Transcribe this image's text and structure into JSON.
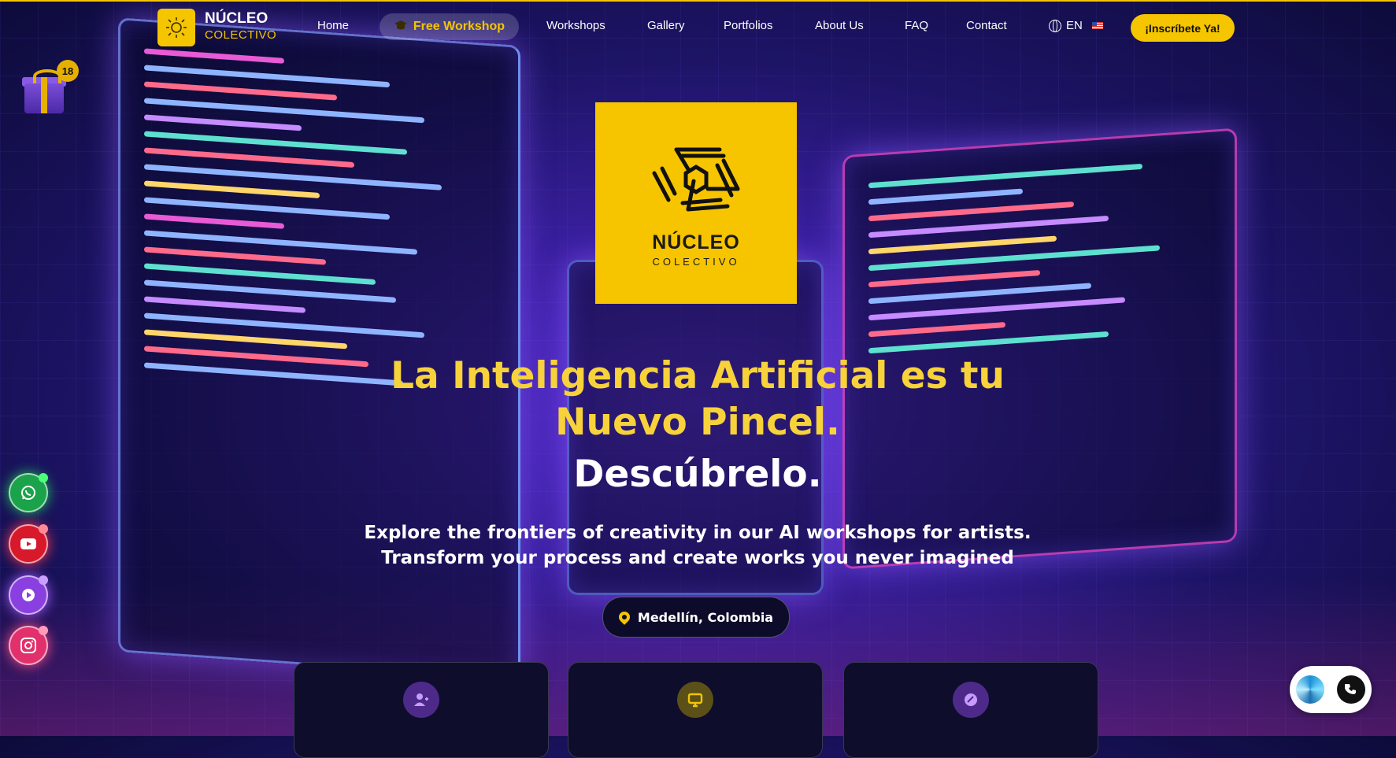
{
  "brand": {
    "name": "NÚCLEO",
    "sub": "COLECTIVO"
  },
  "nav": {
    "home": "Home",
    "free_workshop": "Free Workshop",
    "workshops": "Workshops",
    "gallery": "Gallery",
    "portfolios": "Portfolios",
    "about": "About Us",
    "faq": "FAQ",
    "contact": "Contact",
    "language": "EN",
    "cta": "¡Inscríbete Ya!"
  },
  "gift": {
    "badge_count": "18",
    "icon": "gift-icon"
  },
  "social": [
    {
      "name": "whatsapp",
      "icon": "whatsapp-icon",
      "color": "#1aa34a"
    },
    {
      "name": "youtube",
      "icon": "youtube-icon",
      "color": "#d8182b"
    },
    {
      "name": "media-player",
      "icon": "play-icon",
      "color": "#8a3fe0"
    },
    {
      "name": "instagram",
      "icon": "instagram-icon",
      "color": "#e2306c"
    }
  ],
  "hero": {
    "logo_name": "NÚCLEO",
    "logo_sub": "COLECTIVO",
    "title_line1": "La Inteligencia Artificial es tu",
    "title_line2": "Nuevo Pincel.",
    "subtitle": "Descúbrelo.",
    "lead_line1": "Explore the frontiers of creativity in our AI workshops for artists.",
    "lead_line2": "Transform your process and create works you never imagined",
    "location": "Medellín, Colombia"
  },
  "cards": [
    {
      "icon": "user-plus-icon"
    },
    {
      "icon": "monitor-icon"
    },
    {
      "icon": "palette-icon"
    }
  ],
  "colors": {
    "accent": "#f5c500",
    "background": "#1d1466",
    "title": "#f7d23a"
  }
}
